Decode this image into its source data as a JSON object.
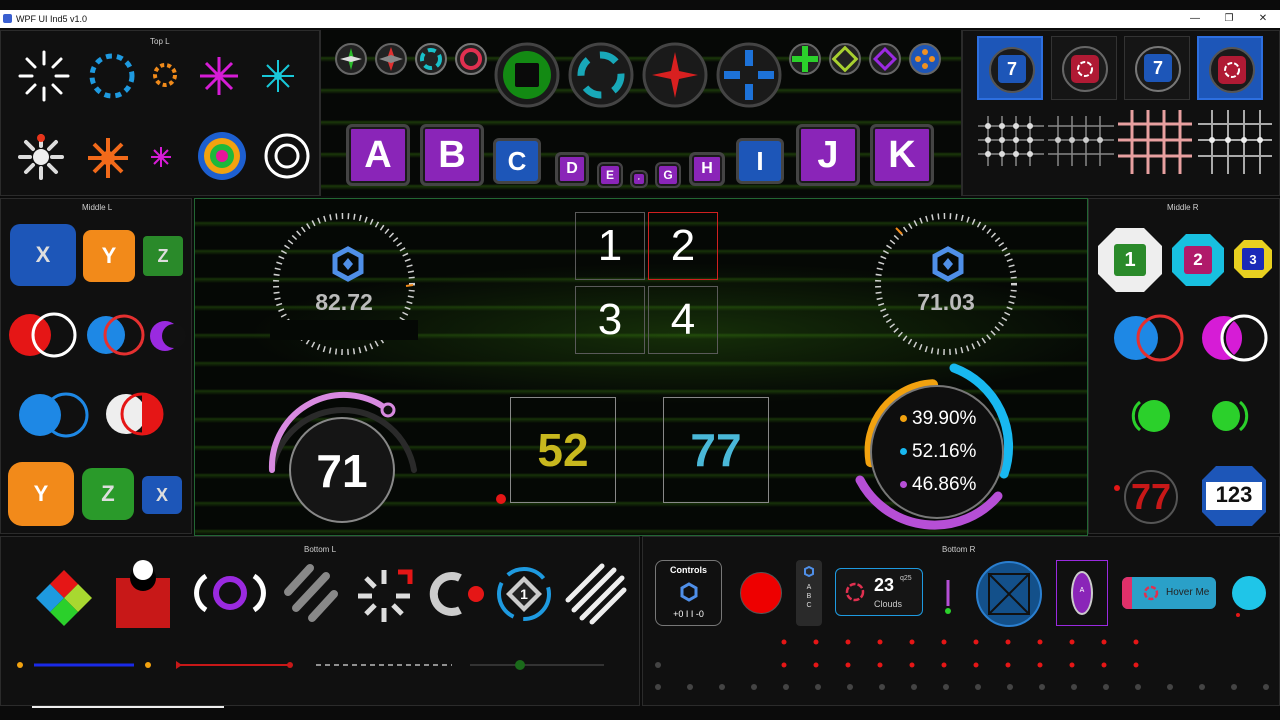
{
  "window": {
    "title": "WPF UI Ind5  v1.0",
    "min": "—",
    "max": "❐",
    "close": "✕"
  },
  "panels": {
    "top_left": "Top L",
    "middle_left": "Middle L",
    "middle_right": "Middle R",
    "bottom_left": "Bottom L",
    "bottom_right": "Bottom R"
  },
  "letters": [
    "A",
    "B",
    "C",
    "D",
    "E",
    "F",
    "G",
    "H",
    "I",
    "J",
    "K"
  ],
  "top_right_badges": [
    "7",
    "7"
  ],
  "grid_numbers": [
    "1",
    "2",
    "3",
    "4"
  ],
  "gauges": {
    "left_value": "82.72",
    "right_value": "71.03",
    "arc_value": "71"
  },
  "squares": {
    "yellow": "52",
    "cyan": "77"
  },
  "ring": {
    "values": [
      "39.90%",
      "52.16%",
      "46.86%"
    ],
    "colors": [
      "#f2a20f",
      "#18b8f0",
      "#b64fd6"
    ]
  },
  "middle_left": {
    "tiles_top": [
      "X",
      "Y",
      "Z"
    ],
    "tiles_bottom": [
      "Y",
      "Z",
      "X"
    ]
  },
  "middle_right": {
    "shapes": [
      "1",
      "2",
      "3"
    ],
    "red_number": "77",
    "badge": "123"
  },
  "bottom_right": {
    "controls_title": "Controls",
    "controls_value": "+0 I I -0",
    "vertical_letters": [
      "A",
      "B",
      "C"
    ],
    "weather_temp": "23",
    "weather_sup": "q25",
    "weather_label": "Clouds",
    "pill_letter": "A",
    "hover_label": "Hover Me"
  },
  "colors": {
    "purple": "#8a25b8",
    "blue": "#1d56b8",
    "green": "#36c62a",
    "red": "#e51616",
    "cyan": "#1fc5e8",
    "orange": "#f28a1a"
  }
}
